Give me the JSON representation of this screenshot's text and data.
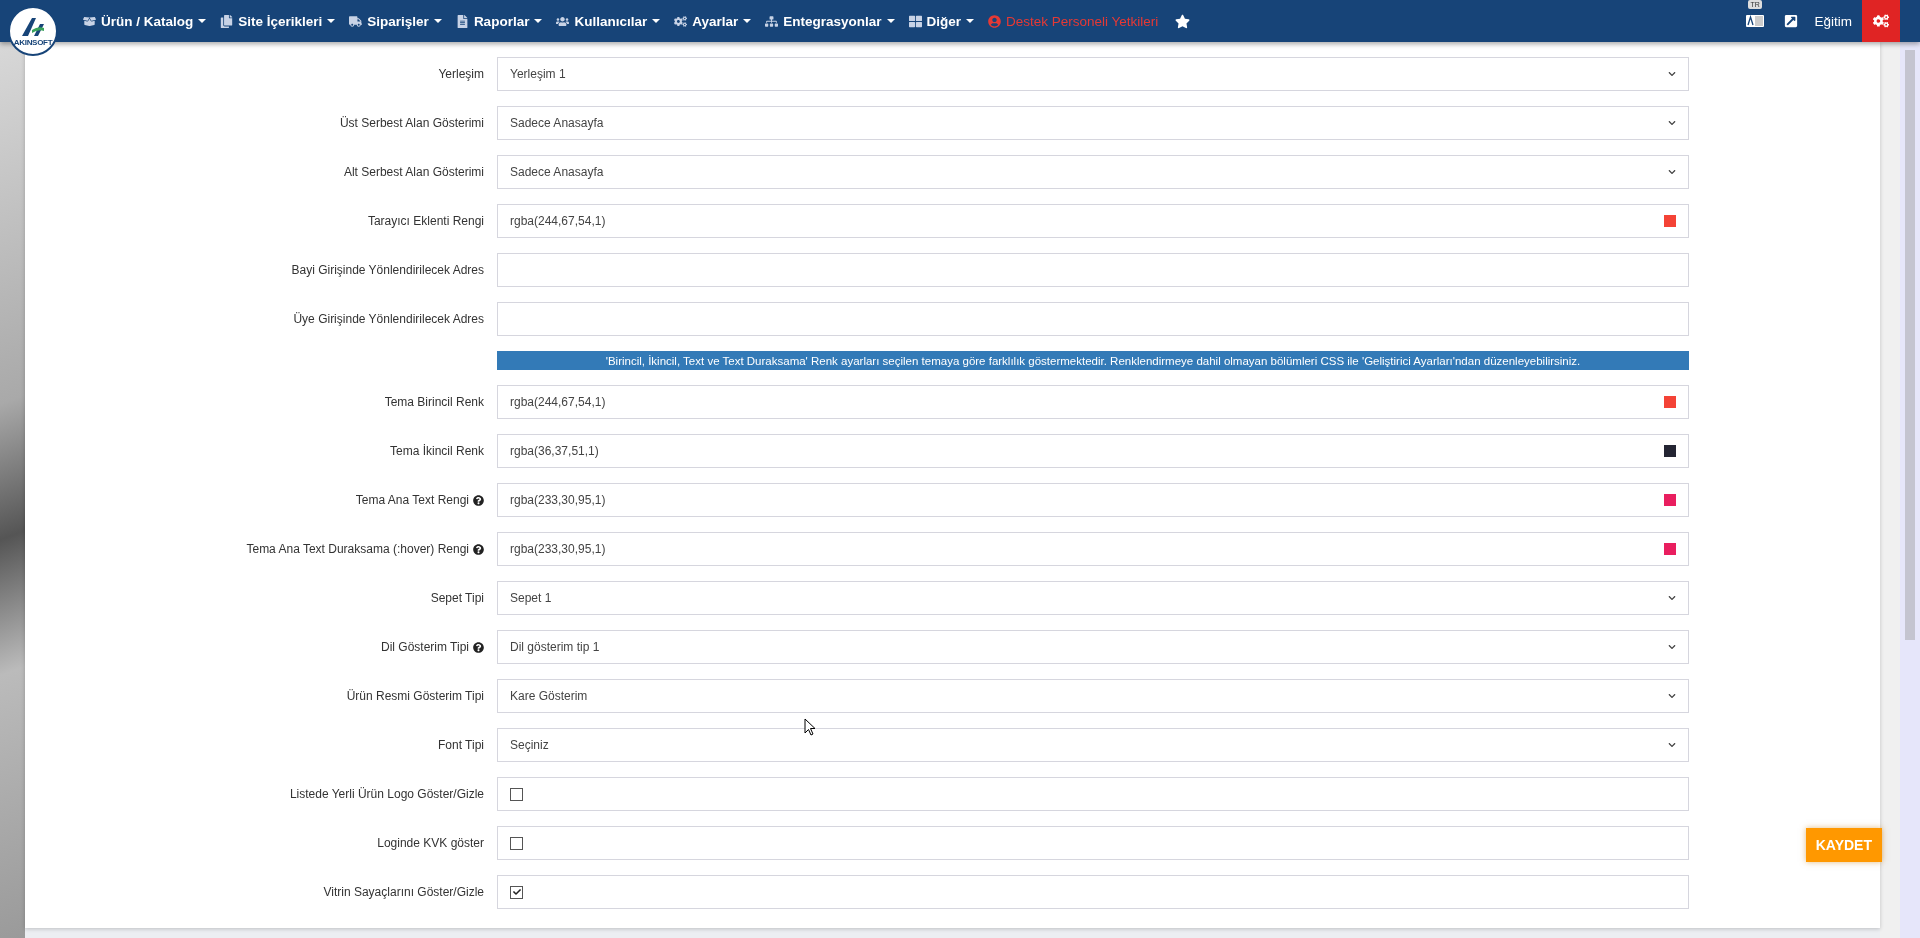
{
  "logo": {
    "text": "AKINSOFT"
  },
  "nav": [
    {
      "label": "Ürün / Katalog",
      "kind": "menu"
    },
    {
      "label": "Site İçerikleri",
      "kind": "menu"
    },
    {
      "label": "Siparişler",
      "kind": "menu"
    },
    {
      "label": "Raporlar",
      "kind": "menu"
    },
    {
      "label": "Kullanıcılar",
      "kind": "menu"
    },
    {
      "label": "Ayarlar",
      "kind": "menu"
    },
    {
      "label": "Entegrasyonlar",
      "kind": "menu"
    },
    {
      "label": "Diğer",
      "kind": "menu"
    },
    {
      "label": "Destek Personeli Yetkileri",
      "kind": "alert"
    }
  ],
  "topright": {
    "language_badge": "TR",
    "user": "Eğitim"
  },
  "rows": [
    {
      "kind": "select",
      "label": "Yerleşim",
      "help": false,
      "value": "Yerleşim 1"
    },
    {
      "kind": "select",
      "label": "Üst Serbest Alan Gösterimi",
      "help": false,
      "value": "Sadece Anasayfa"
    },
    {
      "kind": "select",
      "label": "Alt Serbest Alan Gösterimi",
      "help": false,
      "value": "Sadece Anasayfa"
    },
    {
      "kind": "color",
      "label": "Tarayıcı Eklenti Rengi",
      "help": false,
      "value": "rgba(244,67,54,1)",
      "color": "#f44336"
    },
    {
      "kind": "text",
      "label": "Bayi Girişinde Yönlendirilecek Adres",
      "help": false
    },
    {
      "kind": "text",
      "label": "Üye Girişinde Yönlendirilecek Adres",
      "help": false
    },
    {
      "kind": "note",
      "text": "'Birincil, İkincil, Text ve Text Duraksama' Renk ayarları seçilen temaya göre farklılık göstermektedir. Renklendirmeye dahil olmayan bölümleri CSS ile 'Geliştirici Ayarları'ndan düzenleyebilirsiniz."
    },
    {
      "kind": "color",
      "label": "Tema Birincil Renk",
      "help": false,
      "value": "rgba(244,67,54,1)",
      "color": "#f44336"
    },
    {
      "kind": "color",
      "label": "Tema İkincil Renk",
      "help": false,
      "value": "rgba(36,37,51,1)",
      "color": "#242533"
    },
    {
      "kind": "color",
      "label": "Tema Ana Text Rengi",
      "help": true,
      "value": "rgba(233,30,95,1)",
      "color": "#e91e5f"
    },
    {
      "kind": "color",
      "label": "Tema Ana Text Duraksama (:hover) Rengi",
      "help": true,
      "value": "rgba(233,30,95,1)",
      "color": "#e91e5f"
    },
    {
      "kind": "select",
      "label": "Sepet Tipi",
      "help": false,
      "value": "Sepet 1"
    },
    {
      "kind": "select",
      "label": "Dil Gösterim Tipi",
      "help": true,
      "value": "Dil gösterim tip 1"
    },
    {
      "kind": "select",
      "label": "Ürün Resmi Gösterim Tipi",
      "help": false,
      "value": "Kare Gösterim"
    },
    {
      "kind": "select",
      "label": "Font Tipi",
      "help": false,
      "value": "Seçiniz"
    },
    {
      "kind": "checkbox",
      "label": "Listede Yerli Ürün Logo Göster/Gizle",
      "help": false,
      "checked": false
    },
    {
      "kind": "checkbox",
      "label": "Loginde KVK göster",
      "help": false,
      "checked": false
    },
    {
      "kind": "checkbox",
      "label": "Vitrin Sayaçlarını Göster/Gizle",
      "help": false,
      "checked": true
    }
  ],
  "save_button": "KAYDET"
}
